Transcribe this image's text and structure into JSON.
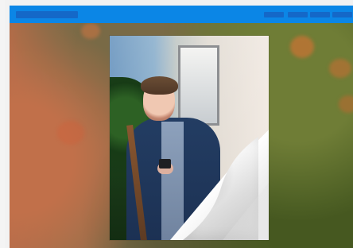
{
  "page": {
    "title": ""
  },
  "header": {
    "brand": "",
    "nav_items": [
      "",
      "",
      "",
      ""
    ]
  },
  "content": {
    "image_caption": ""
  }
}
